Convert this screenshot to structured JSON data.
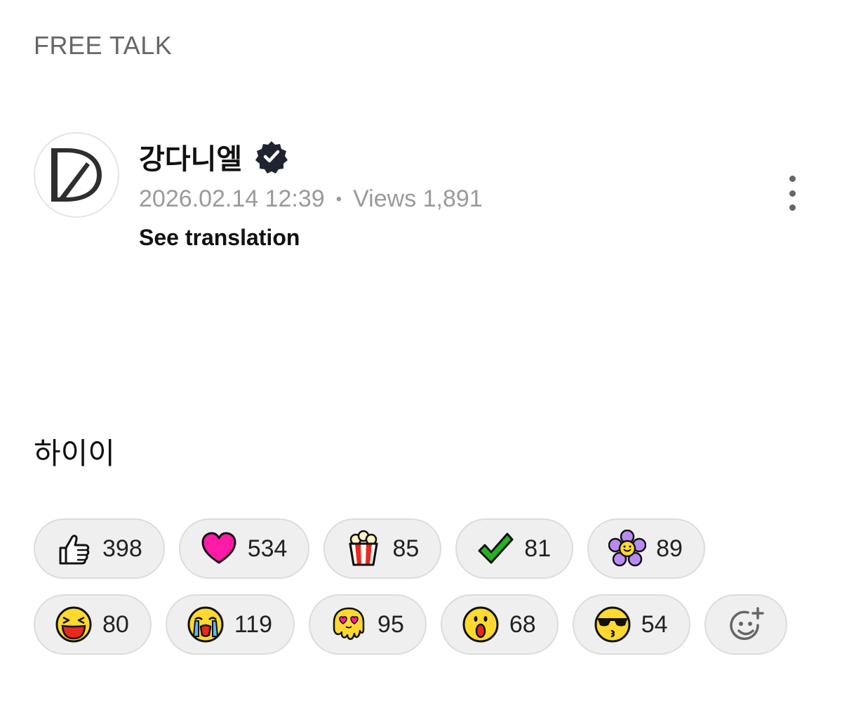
{
  "board": {
    "label": "FREE TALK"
  },
  "post": {
    "author": "강다니엘",
    "verified": true,
    "date": "2026.02.14 12:39",
    "views_label": "Views 1,891",
    "translate_label": "See translation",
    "body": "하이이"
  },
  "reactions": [
    {
      "icon": "thumbs-up-icon",
      "count": "398"
    },
    {
      "icon": "heart-icon",
      "count": "534"
    },
    {
      "icon": "popcorn-icon",
      "count": "85"
    },
    {
      "icon": "checkmark-icon",
      "count": "81"
    },
    {
      "icon": "flower-icon",
      "count": "89"
    },
    {
      "icon": "laughing-face-icon",
      "count": "80"
    },
    {
      "icon": "crying-face-icon",
      "count": "119"
    },
    {
      "icon": "melting-heart-eyes-icon",
      "count": "95"
    },
    {
      "icon": "surprised-face-icon",
      "count": "68"
    },
    {
      "icon": "sunglasses-kiss-icon",
      "count": "54"
    }
  ],
  "colors": {
    "pill_bg": "#efefef",
    "heart": "#ff1aa8",
    "check": "#22b31d",
    "flower": "#b98cf5",
    "face_yellow": "#ffd92e"
  }
}
